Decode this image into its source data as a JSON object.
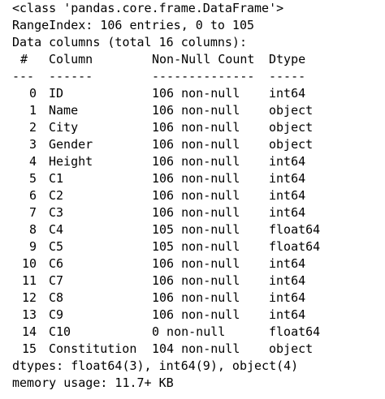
{
  "console": {
    "class_line": "<class 'pandas.core.frame.DataFrame'>",
    "range_index": "RangeIndex: 106 entries, 0 to 105",
    "data_columns": "Data columns (total 16 columns):",
    "header": {
      "idx": "#",
      "column": "Column",
      "non_null": "Non-Null Count",
      "dtype": "Dtype"
    },
    "separator": {
      "idx": "---",
      "column": "------",
      "non_null": "--------------",
      "dtype": "-----"
    },
    "rows": [
      {
        "idx": "0",
        "column": "ID",
        "non_null": "106 non-null",
        "dtype": "int64"
      },
      {
        "idx": "1",
        "column": "Name",
        "non_null": "106 non-null",
        "dtype": "object"
      },
      {
        "idx": "2",
        "column": "City",
        "non_null": "106 non-null",
        "dtype": "object"
      },
      {
        "idx": "3",
        "column": "Gender",
        "non_null": "106 non-null",
        "dtype": "object"
      },
      {
        "idx": "4",
        "column": "Height",
        "non_null": "106 non-null",
        "dtype": "int64"
      },
      {
        "idx": "5",
        "column": "C1",
        "non_null": "106 non-null",
        "dtype": "int64"
      },
      {
        "idx": "6",
        "column": "C2",
        "non_null": "106 non-null",
        "dtype": "int64"
      },
      {
        "idx": "7",
        "column": "C3",
        "non_null": "106 non-null",
        "dtype": "int64"
      },
      {
        "idx": "8",
        "column": "C4",
        "non_null": "105 non-null",
        "dtype": "float64"
      },
      {
        "idx": "9",
        "column": "C5",
        "non_null": "105 non-null",
        "dtype": "float64"
      },
      {
        "idx": "10",
        "column": "C6",
        "non_null": "106 non-null",
        "dtype": "int64"
      },
      {
        "idx": "11",
        "column": "C7",
        "non_null": "106 non-null",
        "dtype": "int64"
      },
      {
        "idx": "12",
        "column": "C8",
        "non_null": "106 non-null",
        "dtype": "int64"
      },
      {
        "idx": "13",
        "column": "C9",
        "non_null": "106 non-null",
        "dtype": "int64"
      },
      {
        "idx": "14",
        "column": "C10",
        "non_null": "0 non-null",
        "dtype": "float64"
      },
      {
        "idx": "15",
        "column": "Constitution",
        "non_null": "104 non-null",
        "dtype": "object"
      }
    ],
    "dtypes": "dtypes: float64(3), int64(9), object(4)",
    "memory_usage": "memory usage: 11.7+ KB"
  }
}
